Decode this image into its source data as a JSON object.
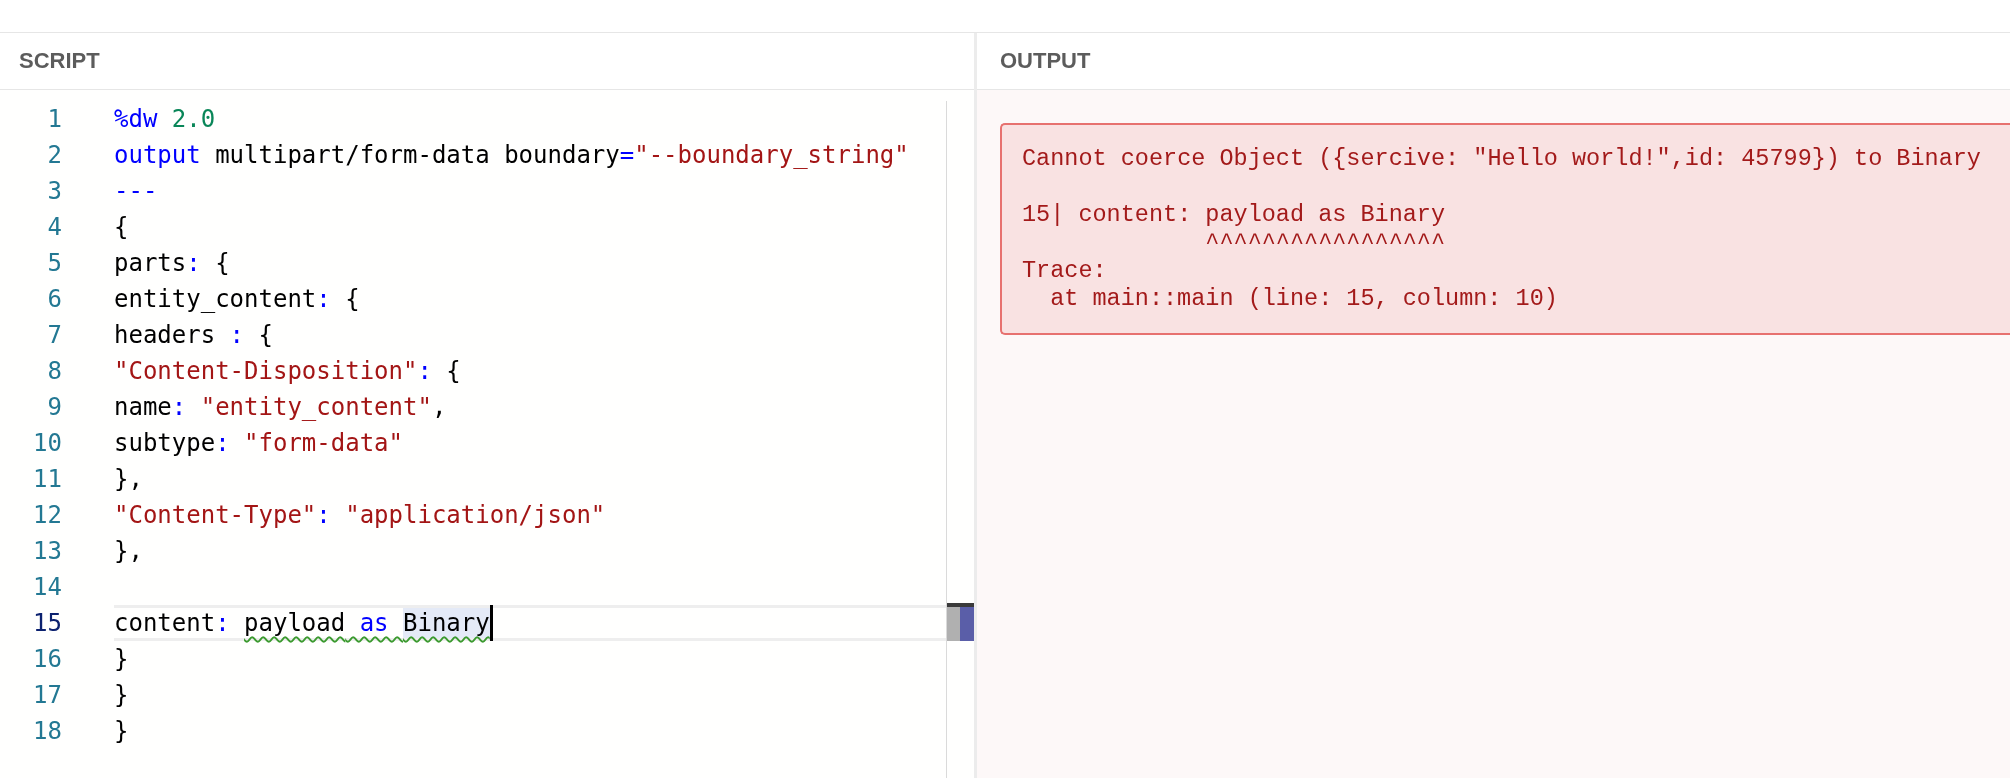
{
  "script_panel": {
    "title": "SCRIPT",
    "lines": [
      {
        "number": "1",
        "current": false,
        "tokens": [
          {
            "text": "%dw ",
            "kind": "keyword",
            "warning": false,
            "highlighted": false
          },
          {
            "text": "2.0",
            "kind": "number",
            "warning": false,
            "highlighted": false
          }
        ]
      },
      {
        "number": "2",
        "current": false,
        "tokens": [
          {
            "text": "output ",
            "kind": "keyword",
            "warning": false,
            "highlighted": false
          },
          {
            "text": "multipart/form-data boundary",
            "kind": "plain",
            "warning": false,
            "highlighted": false
          },
          {
            "text": "=",
            "kind": "punct",
            "warning": false,
            "highlighted": false
          },
          {
            "text": "\"--boundary_string\"",
            "kind": "string",
            "warning": false,
            "highlighted": false
          }
        ]
      },
      {
        "number": "3",
        "current": false,
        "tokens": [
          {
            "text": "---",
            "kind": "keyword",
            "warning": false,
            "highlighted": false
          }
        ]
      },
      {
        "number": "4",
        "current": false,
        "tokens": [
          {
            "text": "{",
            "kind": "plain",
            "warning": false,
            "highlighted": false
          }
        ]
      },
      {
        "number": "5",
        "current": false,
        "tokens": [
          {
            "text": "parts",
            "kind": "plain",
            "warning": false,
            "highlighted": false
          },
          {
            "text": ": ",
            "kind": "punct",
            "warning": false,
            "highlighted": false
          },
          {
            "text": "{",
            "kind": "plain",
            "warning": false,
            "highlighted": false
          }
        ]
      },
      {
        "number": "6",
        "current": false,
        "tokens": [
          {
            "text": "entity_content",
            "kind": "plain",
            "warning": false,
            "highlighted": false
          },
          {
            "text": ": ",
            "kind": "punct",
            "warning": false,
            "highlighted": false
          },
          {
            "text": "{",
            "kind": "plain",
            "warning": false,
            "highlighted": false
          }
        ]
      },
      {
        "number": "7",
        "current": false,
        "tokens": [
          {
            "text": "headers ",
            "kind": "plain",
            "warning": false,
            "highlighted": false
          },
          {
            "text": ": ",
            "kind": "punct",
            "warning": false,
            "highlighted": false
          },
          {
            "text": "{",
            "kind": "plain",
            "warning": false,
            "highlighted": false
          }
        ]
      },
      {
        "number": "8",
        "current": false,
        "tokens": [
          {
            "text": "\"Content-Disposition\"",
            "kind": "string",
            "warning": false,
            "highlighted": false
          },
          {
            "text": ": ",
            "kind": "punct",
            "warning": false,
            "highlighted": false
          },
          {
            "text": "{",
            "kind": "plain",
            "warning": false,
            "highlighted": false
          }
        ]
      },
      {
        "number": "9",
        "current": false,
        "tokens": [
          {
            "text": "name",
            "kind": "plain",
            "warning": false,
            "highlighted": false
          },
          {
            "text": ": ",
            "kind": "punct",
            "warning": false,
            "highlighted": false
          },
          {
            "text": "\"entity_content\"",
            "kind": "string",
            "warning": false,
            "highlighted": false
          },
          {
            "text": ",",
            "kind": "plain",
            "warning": false,
            "highlighted": false
          }
        ]
      },
      {
        "number": "10",
        "current": false,
        "tokens": [
          {
            "text": "subtype",
            "kind": "plain",
            "warning": false,
            "highlighted": false
          },
          {
            "text": ": ",
            "kind": "punct",
            "warning": false,
            "highlighted": false
          },
          {
            "text": "\"form-data\"",
            "kind": "string",
            "warning": false,
            "highlighted": false
          }
        ]
      },
      {
        "number": "11",
        "current": false,
        "tokens": [
          {
            "text": "},",
            "kind": "plain",
            "warning": false,
            "highlighted": false
          }
        ]
      },
      {
        "number": "12",
        "current": false,
        "tokens": [
          {
            "text": "\"Content-Type\"",
            "kind": "string",
            "warning": false,
            "highlighted": false
          },
          {
            "text": ": ",
            "kind": "punct",
            "warning": false,
            "highlighted": false
          },
          {
            "text": "\"application/json\"",
            "kind": "string",
            "warning": false,
            "highlighted": false
          }
        ]
      },
      {
        "number": "13",
        "current": false,
        "tokens": [
          {
            "text": "},",
            "kind": "plain",
            "warning": false,
            "highlighted": false
          }
        ]
      },
      {
        "number": "14",
        "current": false
      },
      {
        "number": "15",
        "current": true,
        "tokens": [
          {
            "text": "content",
            "kind": "plain",
            "warning": false,
            "highlighted": false
          },
          {
            "text": ": ",
            "kind": "punct",
            "warning": false,
            "highlighted": false
          },
          {
            "text": "payload",
            "kind": "plain",
            "warning": true,
            "highlighted": false
          },
          {
            "text": " as ",
            "kind": "keyword",
            "warning": true,
            "highlighted": false
          },
          {
            "text": "Binary",
            "kind": "plain",
            "warning": true,
            "highlighted": true
          }
        ]
      },
      {
        "number": "16",
        "current": false,
        "tokens": [
          {
            "text": "}",
            "kind": "plain",
            "warning": false,
            "highlighted": false
          }
        ]
      },
      {
        "number": "17",
        "current": false,
        "tokens": [
          {
            "text": "}",
            "kind": "plain",
            "warning": false,
            "highlighted": false
          }
        ]
      },
      {
        "number": "18",
        "current": false,
        "tokens": [
          {
            "text": "}",
            "kind": "plain",
            "warning": false,
            "highlighted": false
          }
        ]
      }
    ]
  },
  "output_panel": {
    "title": "OUTPUT",
    "error": {
      "message": "Cannot coerce Object ({sercive: \"Hello world!\",id: 45799}) to Binary",
      "source_line": "15| content: payload as Binary",
      "pointer": "^^^^^^^^^^^^^^^^^",
      "trace_heading": "Trace:",
      "trace_entries": [
        "at main::main (line: 15, column: 10)"
      ]
    }
  }
}
